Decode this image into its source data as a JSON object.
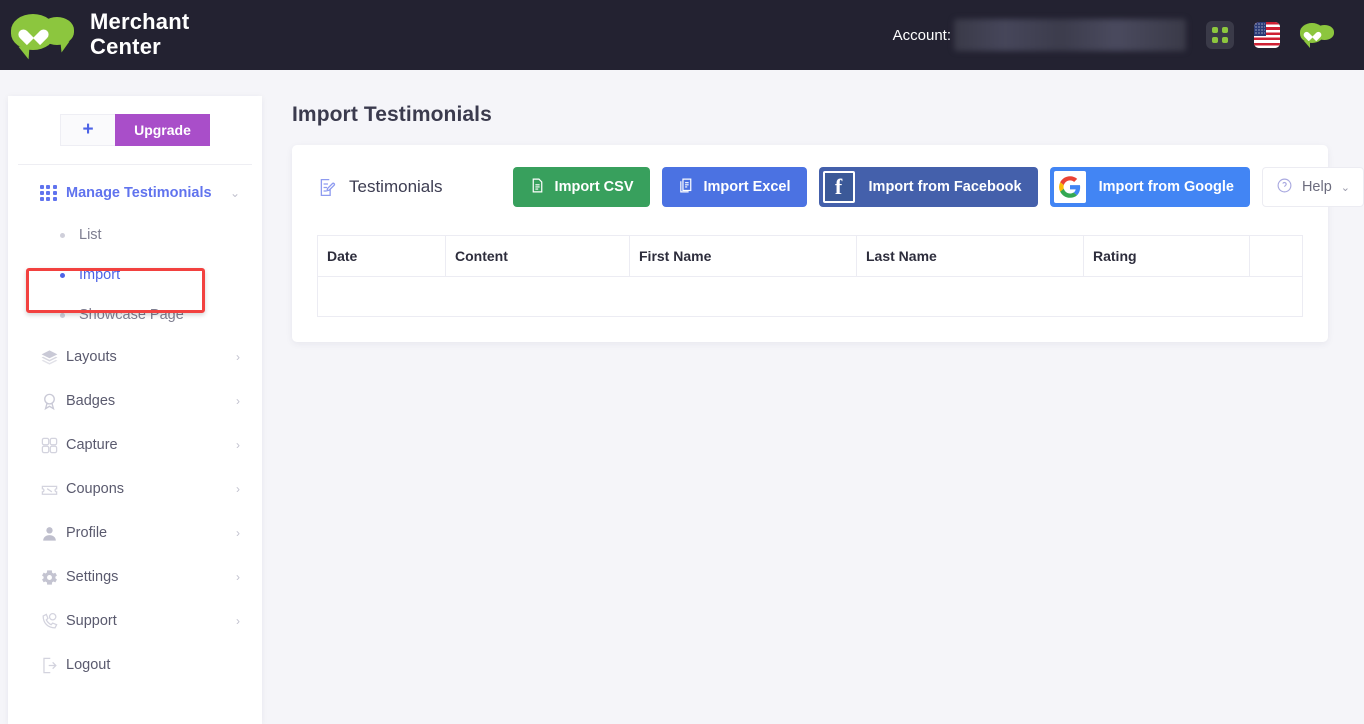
{
  "header": {
    "brand_line1": "Merchant",
    "brand_line2": "Center",
    "account_label": "Account:",
    "account_value": "",
    "apps_icon": "grid-apps-icon",
    "language_icon": "us-flag-icon",
    "brand_icon": "chat-heart-logo-icon"
  },
  "sidebar": {
    "add_label": "+",
    "upgrade_label": "Upgrade",
    "group": {
      "label": "Manage Testimonials",
      "icon": "grid-icon",
      "chevron": "⌄"
    },
    "subitems": [
      {
        "label": "List",
        "current": false
      },
      {
        "label": "Import",
        "current": true
      },
      {
        "label": "Showcase Page",
        "current": false
      }
    ],
    "items": [
      {
        "label": "Layouts",
        "icon": "layers-icon",
        "chevron": "›"
      },
      {
        "label": "Badges",
        "icon": "award-icon",
        "chevron": "›"
      },
      {
        "label": "Capture",
        "icon": "puzzle-icon",
        "chevron": "›"
      },
      {
        "label": "Coupons",
        "icon": "ticket-icon",
        "chevron": "›"
      },
      {
        "label": "Profile",
        "icon": "user-icon",
        "chevron": "›"
      },
      {
        "label": "Settings",
        "icon": "gear-icon",
        "chevron": "›"
      },
      {
        "label": "Support",
        "icon": "phone-support-icon",
        "chevron": "›"
      },
      {
        "label": "Logout",
        "icon": "logout-icon",
        "chevron": ""
      }
    ],
    "highlight_color": "#f2413f"
  },
  "main": {
    "page_title": "Import Testimonials",
    "card": {
      "section_label": "Testimonials",
      "section_icon": "edit-list-icon",
      "buttons": [
        {
          "label": "Import CSV",
          "icon": "file-csv-icon",
          "color": "#38a05d"
        },
        {
          "label": "Import Excel",
          "icon": "file-excel-icon",
          "color": "#4b72e2"
        },
        {
          "label": "Import from Facebook",
          "icon": "facebook-icon",
          "color": "#4460ab"
        },
        {
          "label": "Import from Google",
          "icon": "google-icon",
          "color": "#4285f4"
        }
      ],
      "help": {
        "label": "Help",
        "icon": "question-circle-icon",
        "chevron": "⌄"
      },
      "table": {
        "columns": [
          "Date",
          "Content",
          "First Name",
          "Last Name",
          "Rating",
          ""
        ],
        "rows": []
      }
    }
  },
  "colors": {
    "header_bg": "#232231",
    "page_bg": "#f5f5f9",
    "accent_blue": "#6073ee",
    "accent_purple": "#a94ec9",
    "brand_green": "#8cc63e"
  }
}
